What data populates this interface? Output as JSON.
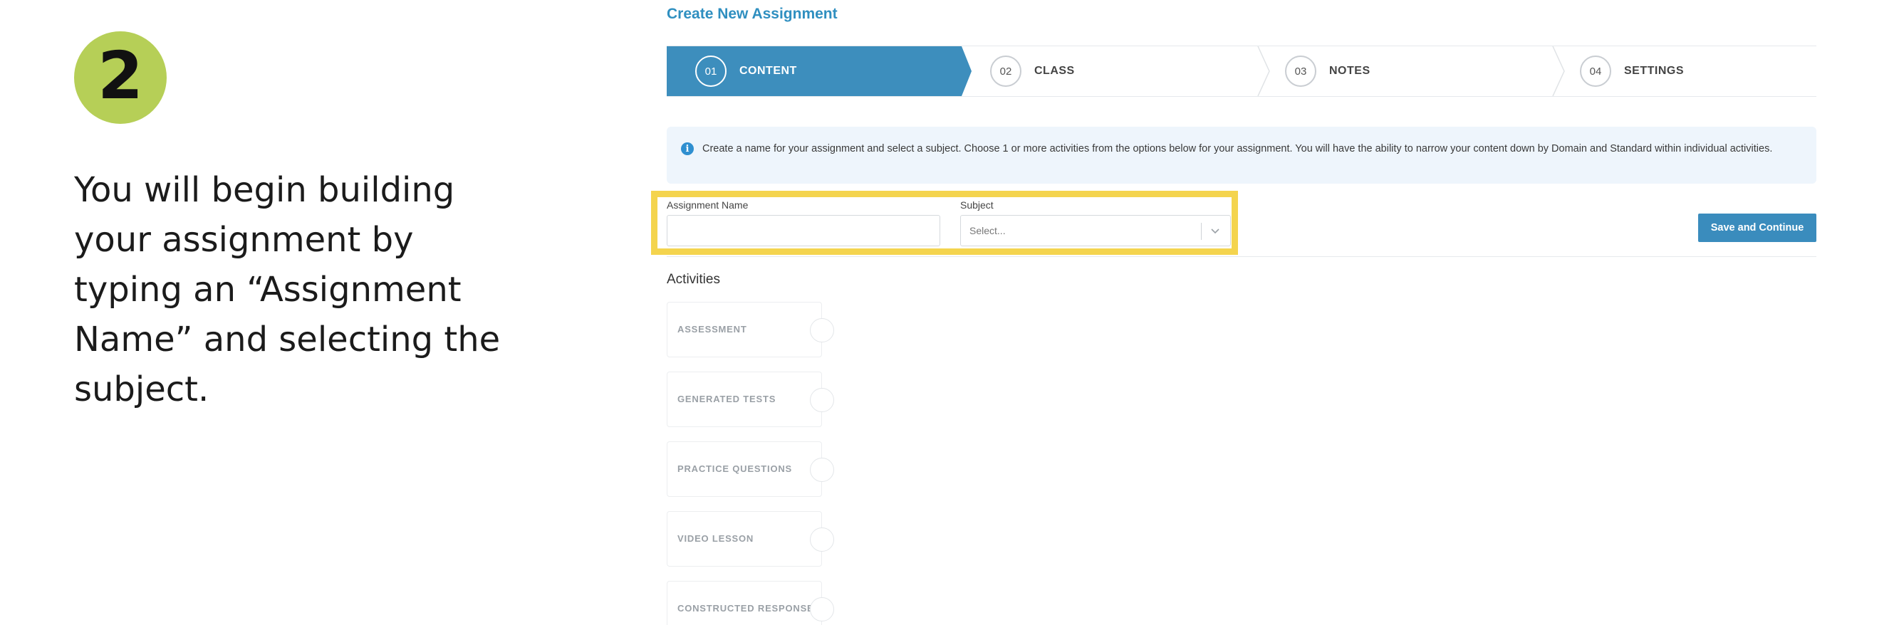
{
  "step_badge": {
    "number": "2",
    "color": "#b6cf57"
  },
  "instruction": "You will begin building your assignment by typing an “Assignment Name” and selecting the subject.",
  "app": {
    "title": "Create New Assignment",
    "steps": [
      {
        "num": "01",
        "label": "CONTENT",
        "active": true
      },
      {
        "num": "02",
        "label": "CLASS",
        "active": false
      },
      {
        "num": "03",
        "label": "NOTES",
        "active": false
      },
      {
        "num": "04",
        "label": "SETTINGS",
        "active": false
      }
    ],
    "info_text": "Create a name for your assignment and select a subject. Choose 1 or more activities from the options below for your assignment. You will have the ability to narrow your content down by Domain and Standard within individual activities.",
    "form": {
      "name_label": "Assignment Name",
      "name_value": "",
      "subject_label": "Subject",
      "subject_placeholder": "Select...",
      "save_label": "Save and Continue"
    },
    "activities_heading": "Activities",
    "activities": [
      "ASSESSMENT",
      "GENERATED TESTS",
      "PRACTICE QUESTIONS",
      "VIDEO LESSON",
      "CONSTRUCTED RESPONSE"
    ]
  },
  "colors": {
    "accent": "#3d8ebd",
    "highlight": "#f4d44e",
    "info_bg": "#eef5fc"
  }
}
